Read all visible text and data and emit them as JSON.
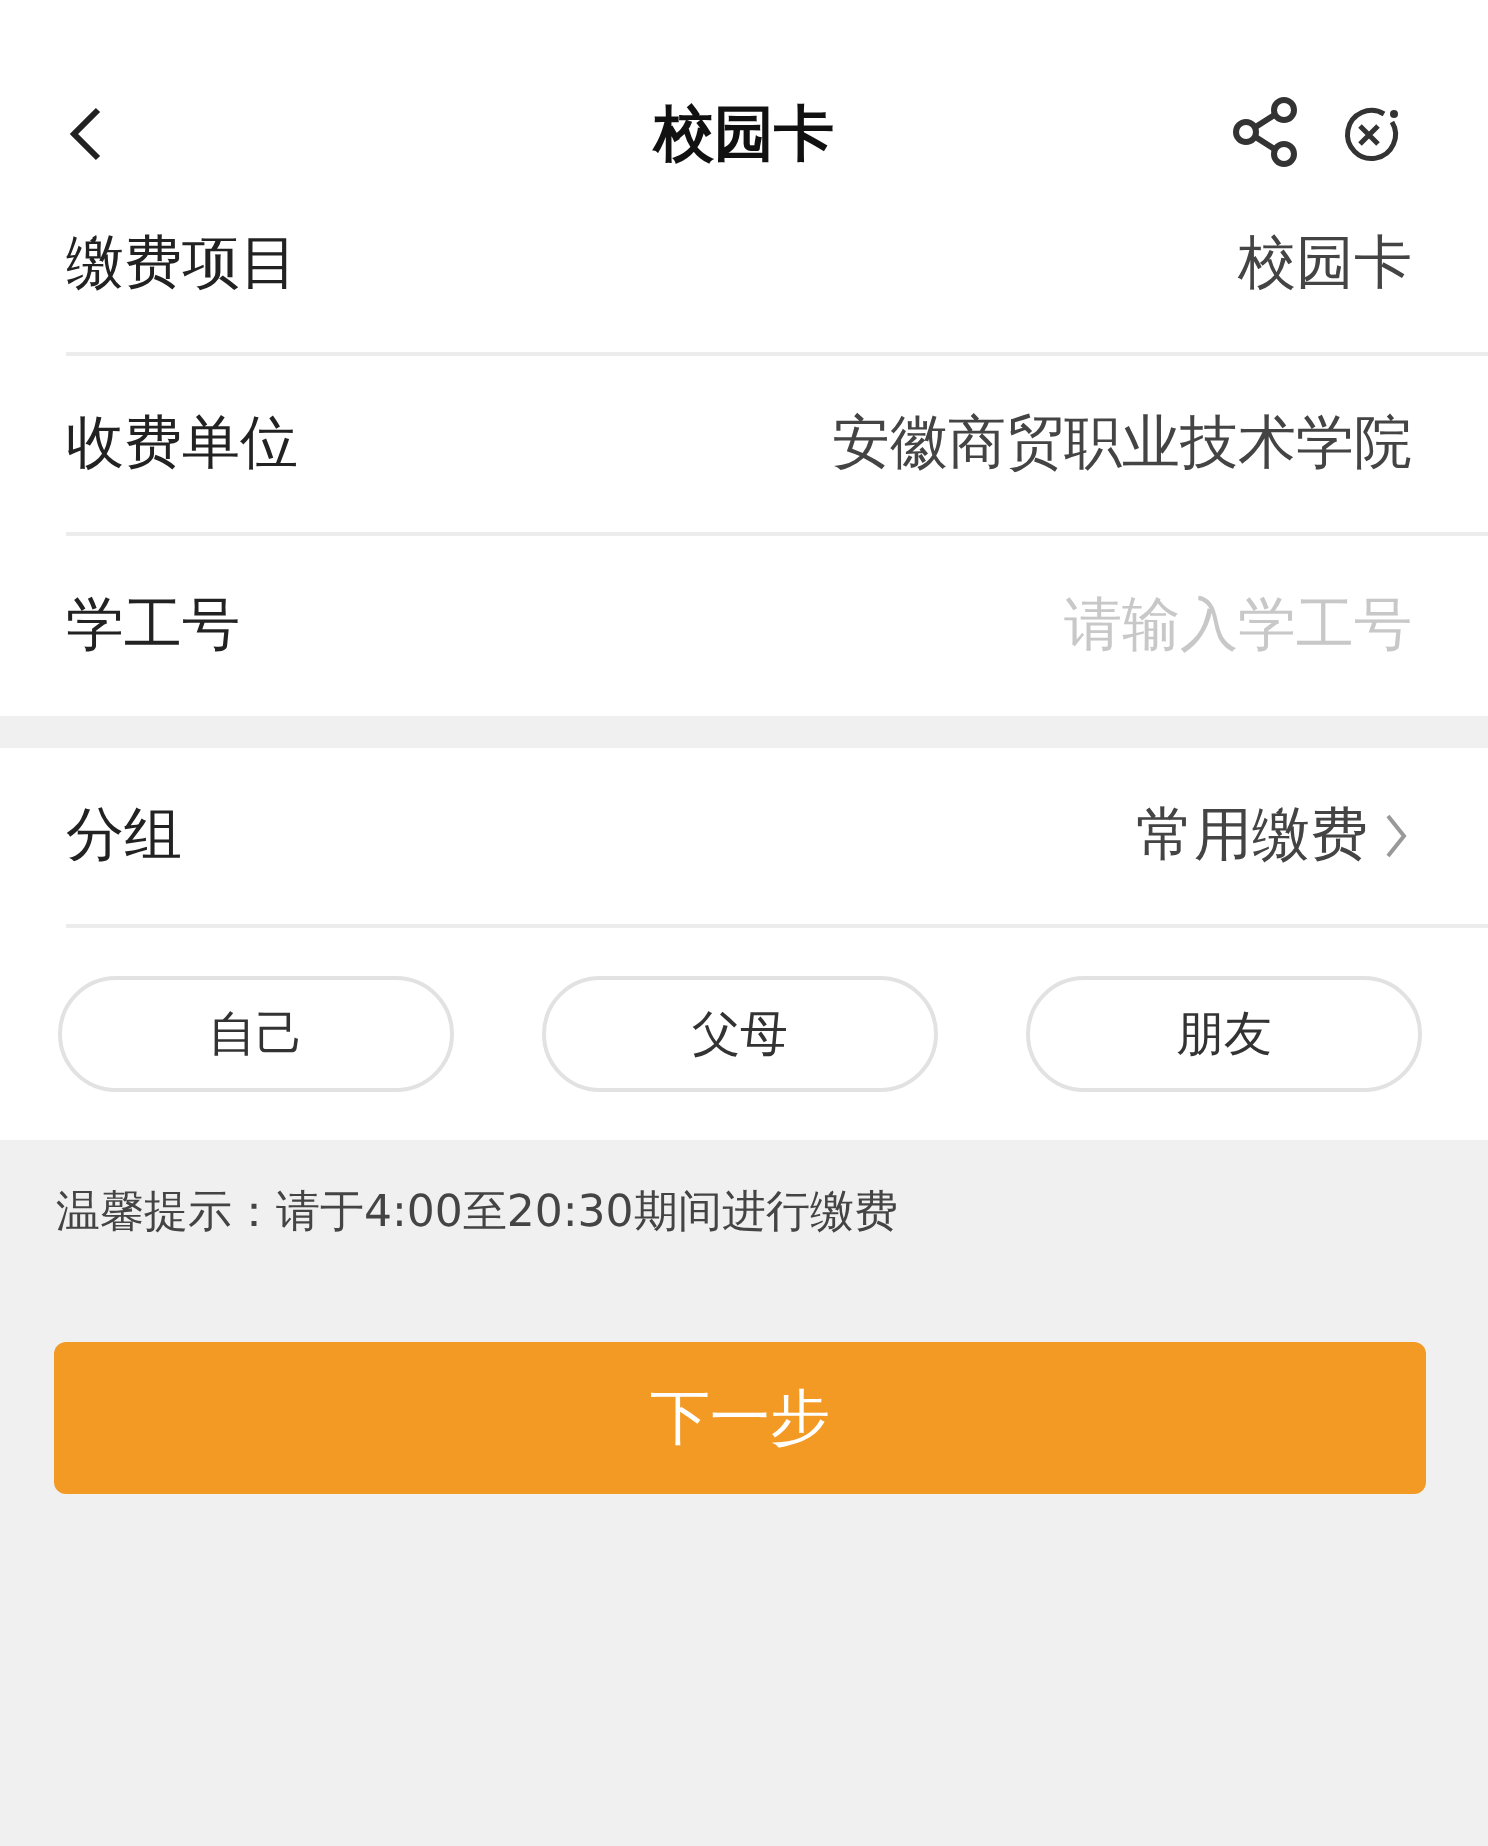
{
  "header": {
    "title": "校园卡"
  },
  "fields": [
    {
      "kind": "text",
      "label": "缴费项目",
      "value": "校园卡"
    },
    {
      "kind": "text",
      "label": "收费单位",
      "value": "安徽商贸职业技术学院"
    },
    {
      "kind": "input",
      "label": "学工号",
      "placeholder": "请输入学工号"
    }
  ],
  "group": {
    "label": "分组",
    "value": "常用缴费"
  },
  "chips": [
    {
      "label": "自己",
      "selected": false
    },
    {
      "label": "父母",
      "selected": false
    },
    {
      "label": "朋友",
      "selected": false
    }
  ],
  "tip": "温馨提示：请于4:00至20:30期间进行缴费",
  "next_button": "下一步"
}
